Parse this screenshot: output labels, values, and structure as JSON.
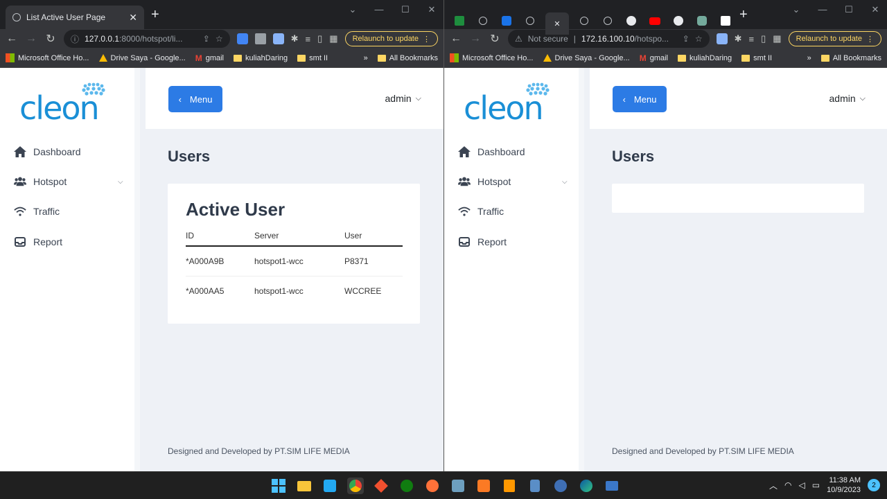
{
  "left_window": {
    "tab_title": "List Active User Page",
    "url_host": "127.0.0.1",
    "url_rest": ":8000/hotspot/li...",
    "relaunch_label": "Relaunch to update"
  },
  "right_window": {
    "security_label": "Not secure",
    "url_host": "172.16.100.10",
    "url_rest": "/hotspo...",
    "relaunch_label": "Relaunch to update"
  },
  "bookmarks": [
    {
      "label": "Microsoft Office Ho...",
      "icon": "microsoft-icon"
    },
    {
      "label": "Drive Saya - Google...",
      "icon": "drive-icon"
    },
    {
      "label": "gmail",
      "icon": "gmail-icon"
    },
    {
      "label": "kuliahDaring",
      "icon": "folder-icon"
    },
    {
      "label": "smt II",
      "icon": "folder-icon"
    }
  ],
  "bookmarks_more": "»",
  "all_bookmarks": "All Bookmarks",
  "app": {
    "logo_text": "cleon",
    "menu_button": "Menu",
    "user": "admin",
    "sidebar": [
      {
        "label": "Dashboard",
        "icon": "home-icon"
      },
      {
        "label": "Hotspot",
        "icon": "users-icon"
      },
      {
        "label": "Traffic",
        "icon": "wifi-icon"
      },
      {
        "label": "Report",
        "icon": "inbox-icon"
      }
    ],
    "page_title": "Users",
    "card_title": "Active User",
    "columns": [
      "ID",
      "Server",
      "User"
    ],
    "rows": [
      [
        "*A000A9B",
        "hotspot1-wcc",
        "P8371"
      ],
      [
        "*A000AA5",
        "hotspot1-wcc",
        "WCCREE"
      ]
    ],
    "footer": "Designed and Developed by PT.SIM LIFE MEDIA"
  },
  "taskbar": {
    "time": "11:38 AM",
    "date": "10/9/2023",
    "notifications": "2"
  },
  "colors": {
    "primary": "#2c7be5",
    "logo_blue": "#1a8fd6",
    "relaunch": "#fdd663"
  }
}
